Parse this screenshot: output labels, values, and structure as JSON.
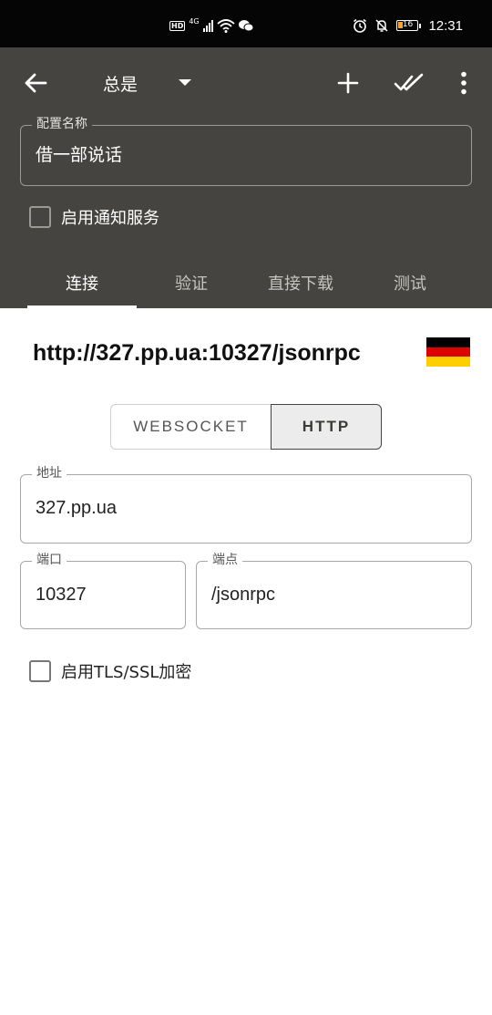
{
  "status_bar": {
    "hd": "HD",
    "network": "4G",
    "battery": "16",
    "time": "12:31"
  },
  "toolbar": {
    "back_icon": "arrow-left-icon",
    "spinner_value": "总是",
    "add_icon": "plus-icon",
    "check_icon": "done-all-icon",
    "menu_icon": "more-vert-icon"
  },
  "config_name": {
    "label": "配置名称",
    "value": "借一部说话"
  },
  "notify": {
    "label": "启用通知服务",
    "checked": false
  },
  "tabs": [
    {
      "label": "连接",
      "active": true
    },
    {
      "label": "验证",
      "active": false
    },
    {
      "label": "直接下载",
      "active": false
    },
    {
      "label": "测试",
      "active": false
    }
  ],
  "connection": {
    "url": "http://327.pp.ua:10327/jsonrpc",
    "flag_colors": [
      "#000000",
      "#DD0000",
      "#FFCE00"
    ],
    "protocol_options": [
      "WEBSOCKET",
      "HTTP"
    ],
    "protocol_selected": "HTTP",
    "address": {
      "label": "地址",
      "value": "327.pp.ua"
    },
    "port": {
      "label": "端口",
      "value": "10327"
    },
    "endpoint": {
      "label": "端点",
      "value": "/jsonrpc"
    },
    "tls": {
      "label": "启用TLS/SSL加密",
      "checked": false
    }
  },
  "colors": {
    "appbar": "#454440",
    "statusbar": "#050505"
  }
}
